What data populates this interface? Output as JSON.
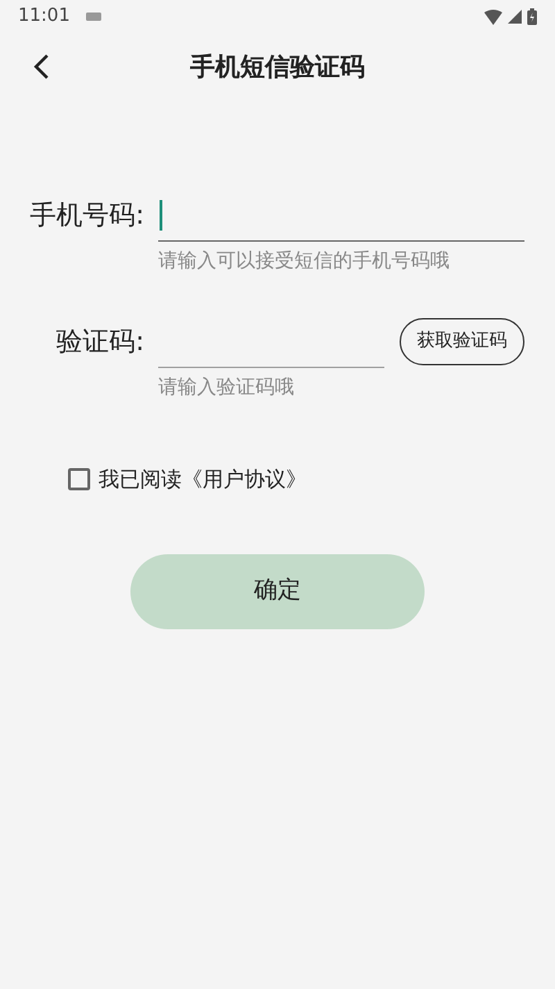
{
  "status_bar": {
    "time": "11:01"
  },
  "header": {
    "title": "手机短信验证码"
  },
  "fields": [
    {
      "label": "手机号码:",
      "hint": "请输入可以接受短信的手机号码哦",
      "focused": true
    },
    {
      "label": "验证码:",
      "hint": "请输入验证码哦",
      "focused": false,
      "button": "获取验证码"
    }
  ],
  "agreement": {
    "text": "我已阅读《用户协议》",
    "checked": false
  },
  "submit": {
    "label": "确定"
  }
}
